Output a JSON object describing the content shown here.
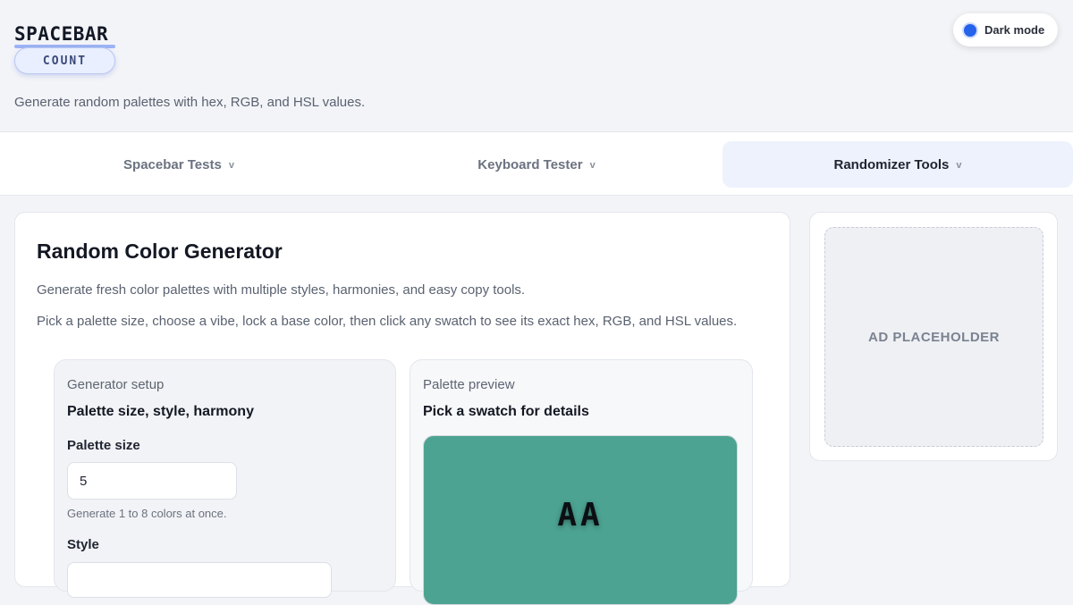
{
  "header": {
    "logo_title": "SPACEBAR",
    "logo_badge": "COUNT",
    "tagline": "Generate random palettes with hex, RGB, and HSL values.",
    "dark_mode_label": "Dark mode"
  },
  "nav": {
    "items": [
      {
        "label": "Spacebar Tests",
        "chevron": "v"
      },
      {
        "label": "Keyboard Tester",
        "chevron": "v"
      },
      {
        "label": "Randomizer Tools",
        "chevron": "v"
      }
    ],
    "active_index": 2
  },
  "main": {
    "title": "Random Color Generator",
    "desc1": "Generate fresh color palettes with multiple styles, harmonies, and easy copy tools.",
    "desc2": "Pick a palette size, choose a vibe, lock a base color, then click any swatch to see its exact hex, RGB, and HSL values.",
    "setup": {
      "kicker": "Generator setup",
      "heading": "Palette size, style, harmony",
      "size_label": "Palette size",
      "size_value": "5",
      "size_hint": "Generate 1 to 8 colors at once.",
      "style_label": "Style"
    },
    "preview": {
      "kicker": "Palette preview",
      "heading": "Pick a swatch for details",
      "swatch_text": "AA",
      "swatch_color": "#4ca392"
    }
  },
  "ad": {
    "label": "AD PLACEHOLDER"
  },
  "colors": {
    "accent": "#2563eb",
    "nav_active_bg": "#eef2fd"
  }
}
